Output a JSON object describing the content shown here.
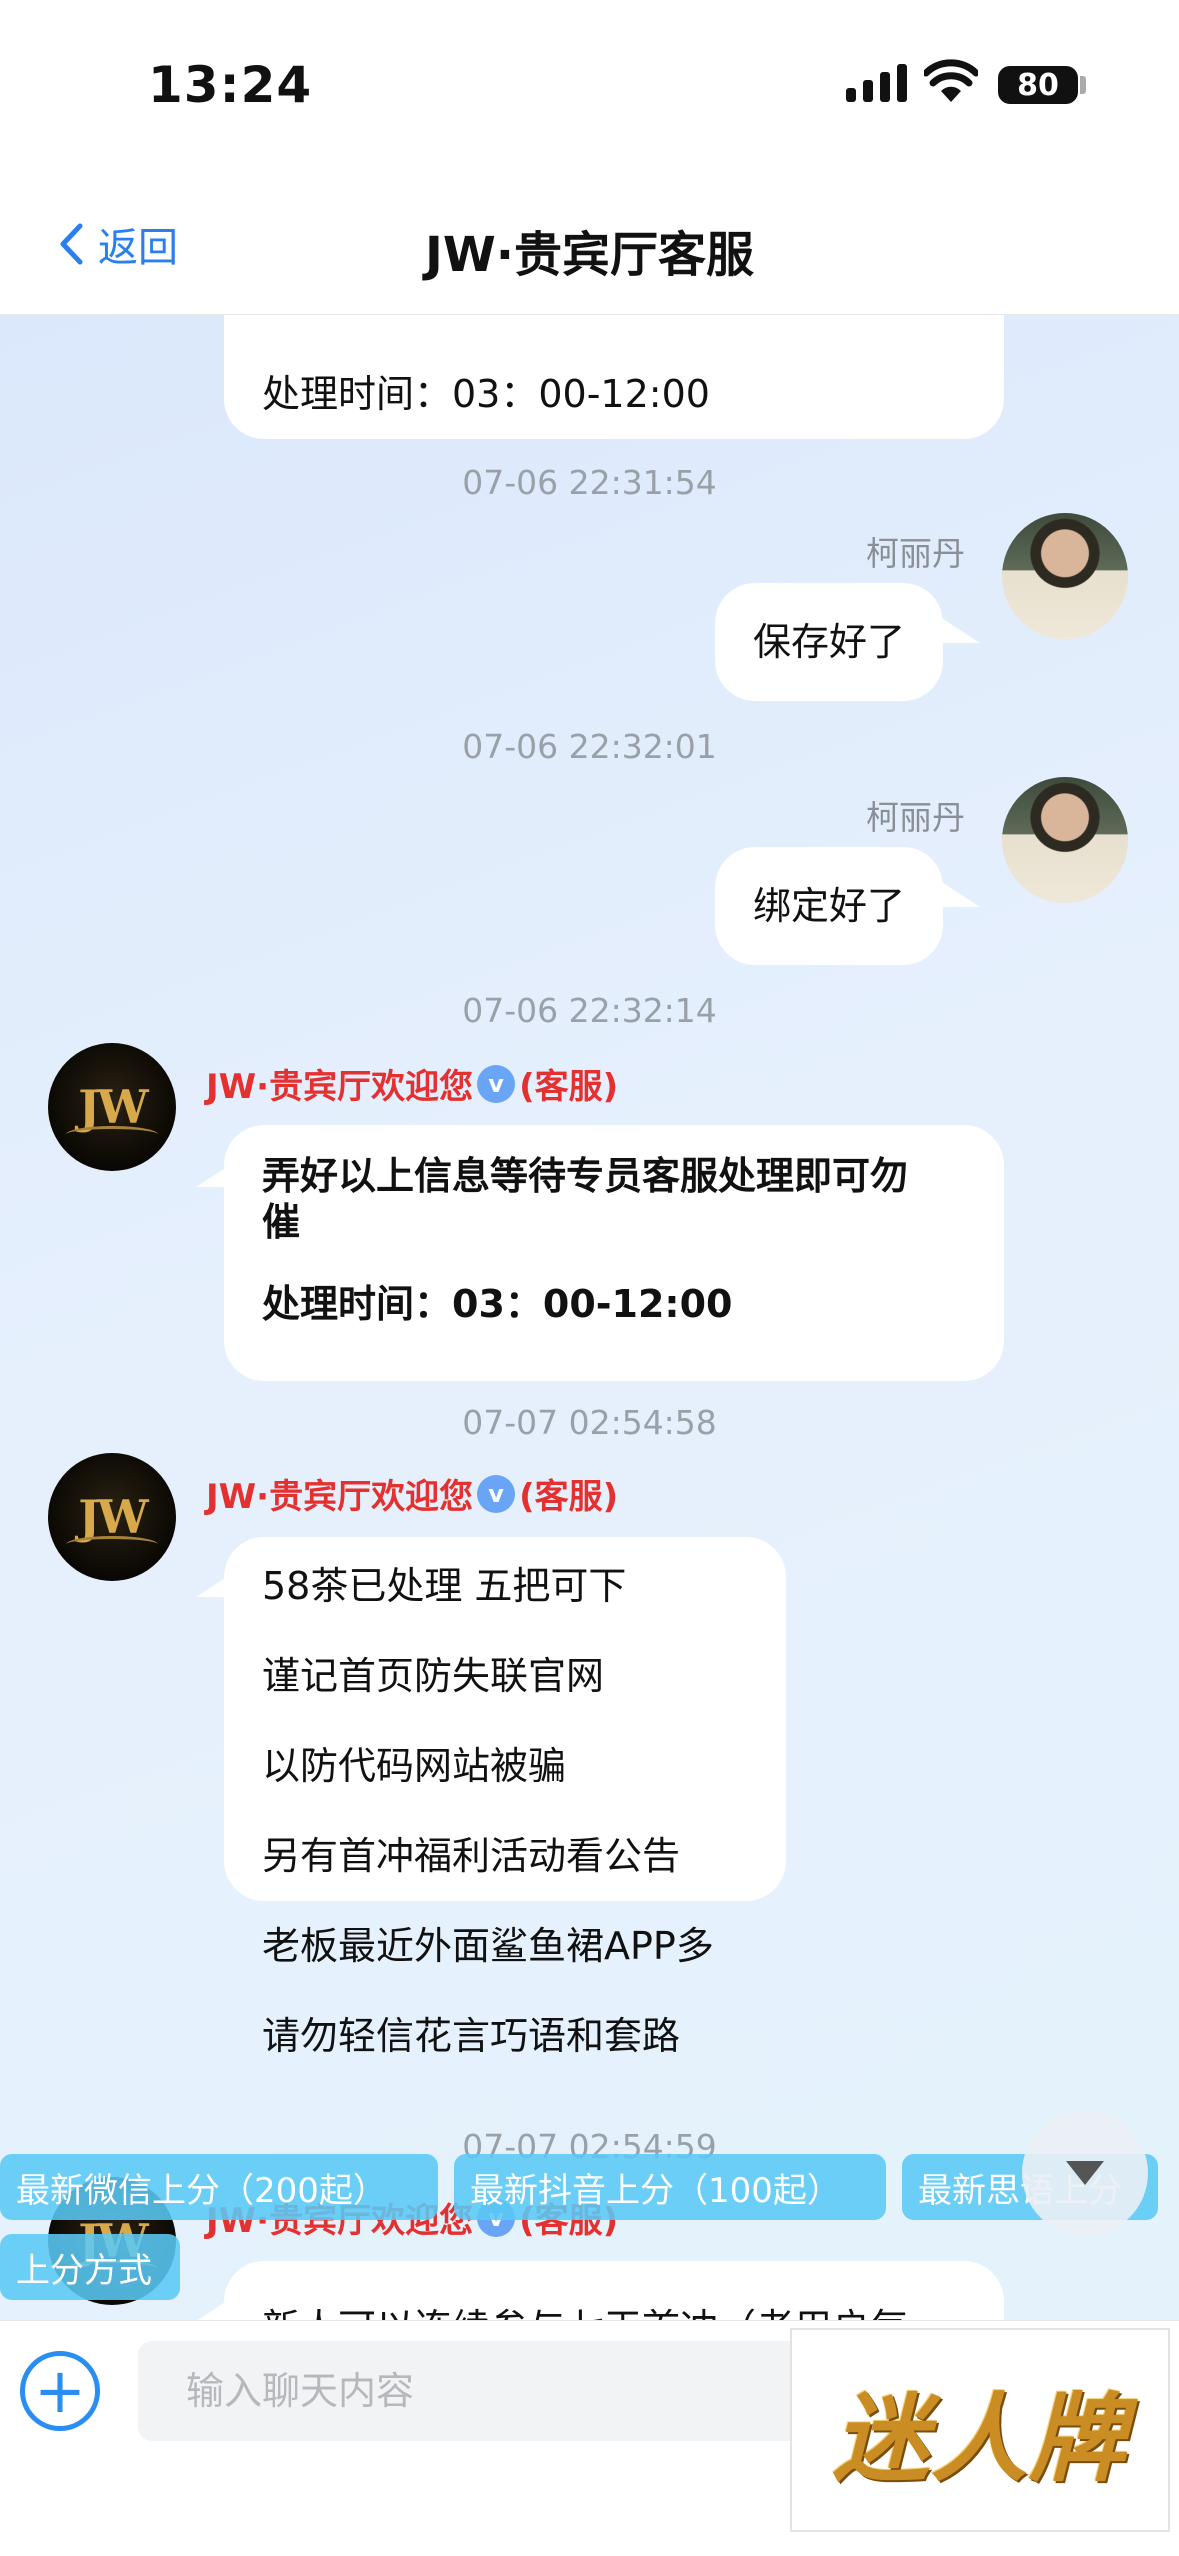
{
  "status_bar": {
    "time": "13:24",
    "battery": "80"
  },
  "nav": {
    "back_label": "返回",
    "title": "JW·贵宾厅客服"
  },
  "messages": {
    "m0": {
      "line": "处理时间：03：00-12:00"
    },
    "ts1": "07-06 22:31:54",
    "m1": {
      "sender": "柯丽丹",
      "text": "保存好了"
    },
    "ts2": "07-06 22:32:01",
    "m2": {
      "sender": "柯丽丹",
      "text": "绑定好了"
    },
    "ts3": "07-06 22:32:14",
    "m3": {
      "sender": "JW·贵宾厅欢迎您",
      "role": "(客服)",
      "avatar": "JW",
      "line1": "弄好以上信息等待专员客服处理即可勿",
      "line2": "催",
      "line3": "处理时间：03：00-12:00"
    },
    "ts4": "07-07 02:54:58",
    "m4": {
      "sender": "JW·贵宾厅欢迎您",
      "role": "(客服)",
      "avatar": "JW",
      "lines": [
        "58茶已处理  五把可下",
        "谨记首页防失联官网",
        "以防代码网站被骗",
        "另有首冲福利活动看公告",
        "老板最近外面鲨鱼裙APP多",
        "请勿轻信花言巧语和套路"
      ]
    },
    "ts5": "07-07 02:54:59",
    "m5": {
      "sender": "JW·贵宾厅欢迎您",
      "role": "(客服)",
      "avatar": "JW",
      "text": "新人可以连续参与七天首冲（老用户每"
    }
  },
  "quick_replies": [
    "最新微信上分（200起）",
    "最新抖音上分（100起）",
    "最新思语上分",
    "上分方式"
  ],
  "input": {
    "placeholder": "输入聊天内容"
  },
  "ad": {
    "text": "迷人牌"
  },
  "colors": {
    "accent": "#2a7ff0",
    "cs_name": "#e53030",
    "chip": "#5ac8f5"
  }
}
